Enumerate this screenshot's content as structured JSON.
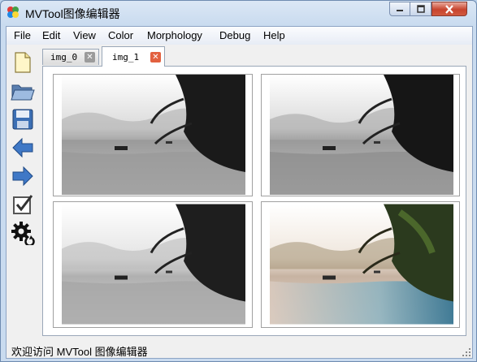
{
  "window": {
    "title": "MVTool图像编辑器"
  },
  "menu": [
    "File",
    "Edit",
    "View",
    "Color",
    "Morphology",
    "Debug",
    "Help"
  ],
  "toolbar": [
    {
      "name": "new-file-icon"
    },
    {
      "name": "open-folder-icon"
    },
    {
      "name": "save-disk-icon"
    },
    {
      "name": "back-arrow-icon"
    },
    {
      "name": "forward-arrow-icon"
    },
    {
      "name": "checkbox-icon"
    },
    {
      "name": "settings-gear-icon"
    }
  ],
  "tabs": [
    {
      "label": "img_0",
      "active": false
    },
    {
      "label": "img_1",
      "active": true
    }
  ],
  "images": [
    {
      "name": "image-grayscale-1"
    },
    {
      "name": "image-grayscale-2"
    },
    {
      "name": "image-grayscale-3"
    },
    {
      "name": "image-color-original"
    }
  ],
  "status": {
    "text": "欢迎访问 MVTool 图像编辑器"
  },
  "colors": {
    "title_close": "#c7442e",
    "tab_close_active": "#e2603f",
    "tab_close_inactive": "#9b9b9b"
  }
}
